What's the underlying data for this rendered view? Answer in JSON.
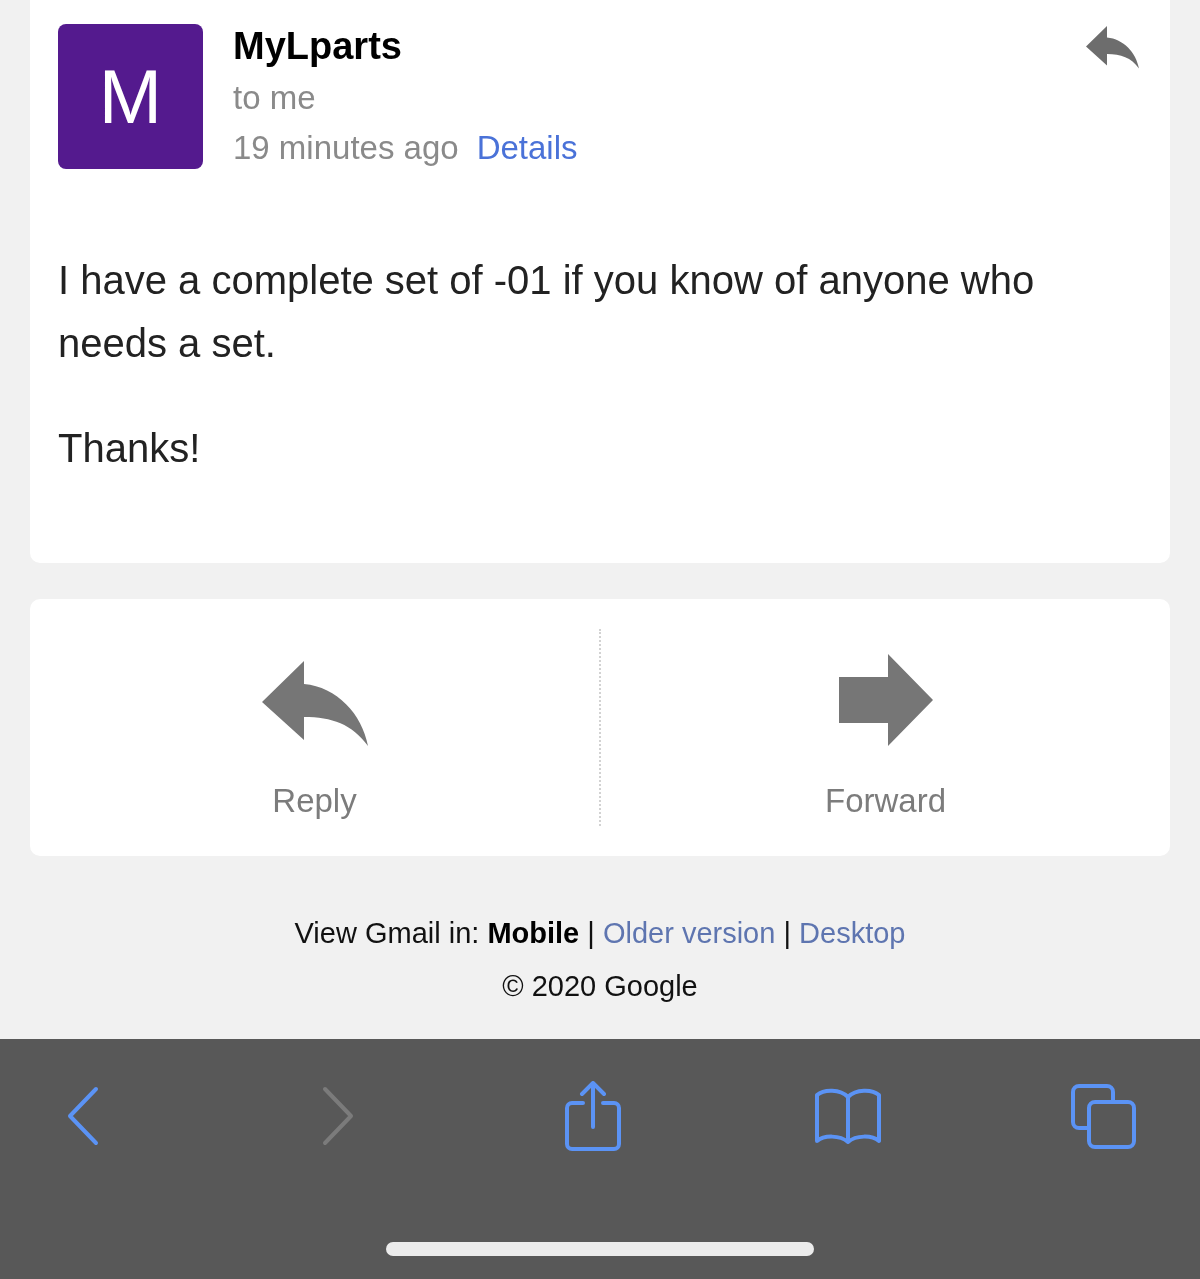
{
  "message": {
    "avatar_letter": "M",
    "sender": "MyLparts",
    "recipient": "to me",
    "time": "19 minutes ago",
    "details": "Details",
    "body": [
      "I have a complete set of -01 if you know of anyone who needs a set.",
      "Thanks!"
    ]
  },
  "actions": [
    {
      "kind": "reply",
      "label": "Reply"
    },
    {
      "kind": "forward",
      "label": "Forward"
    }
  ],
  "footer": {
    "label": "View Gmail in:",
    "views": [
      {
        "label": "Mobile",
        "selected": true
      },
      {
        "label": "Older version",
        "selected": false
      },
      {
        "label": "Desktop",
        "selected": false
      }
    ],
    "separators": [
      "|",
      "|"
    ],
    "copyright": "© 2020 Google"
  },
  "toolbar": [
    {
      "kind": "back",
      "disabled": false
    },
    {
      "kind": "forward",
      "disabled": true
    },
    {
      "kind": "share",
      "disabled": false
    },
    {
      "kind": "bookmarks",
      "disabled": false
    },
    {
      "kind": "tabs",
      "disabled": false
    }
  ]
}
